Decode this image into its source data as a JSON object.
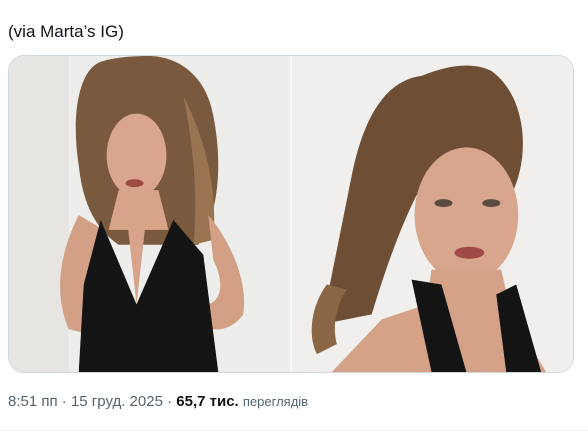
{
  "post": {
    "caption": "(via Marta’s IG)",
    "media": {
      "photos": [
        {
          "label": "photo-1"
        },
        {
          "label": "photo-2"
        }
      ]
    },
    "meta": {
      "time": "8:51 пп",
      "separator1": " · ",
      "date": "15 груд. 2025",
      "separator2": " · ",
      "views_count": "65,7 тис.",
      "views_label": "переглядів"
    }
  },
  "colors": {
    "text_primary": "#0f1419",
    "text_secondary": "#536471",
    "border": "#cfd9de",
    "background": "#ffffff"
  }
}
